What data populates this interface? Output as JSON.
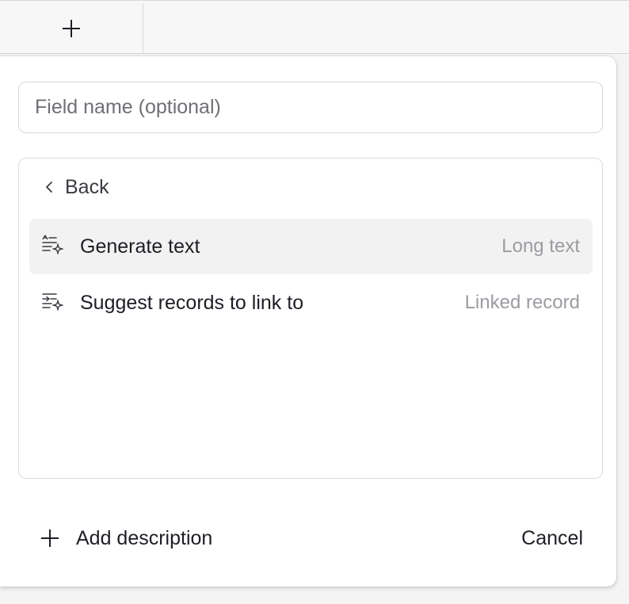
{
  "grid": {
    "add_column_icon": "plus-icon"
  },
  "field_name_input": {
    "placeholder": "Field name (optional)",
    "value": ""
  },
  "type_panel": {
    "back_label": "Back",
    "back_icon": "chevron-left-icon",
    "options": [
      {
        "label": "Generate text",
        "type": "Long text",
        "icon": "ai-text-icon",
        "selected": true
      },
      {
        "label": "Suggest records to link to",
        "type": "Linked record",
        "icon": "ai-link-icon",
        "selected": false
      }
    ]
  },
  "footer": {
    "add_description_label": "Add description",
    "add_description_icon": "plus-icon",
    "cancel_label": "Cancel"
  }
}
